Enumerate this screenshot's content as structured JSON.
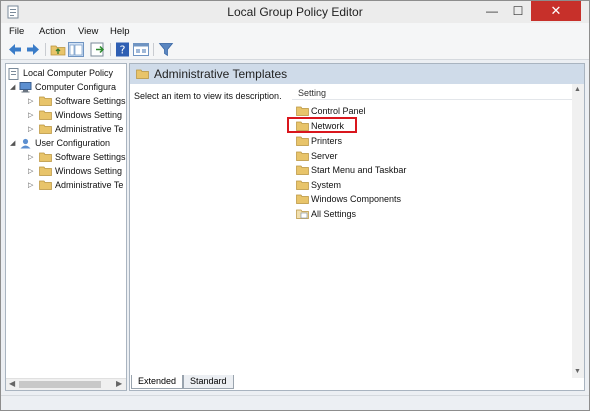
{
  "window": {
    "title": "Local Group Policy Editor",
    "close_glyph": "✕",
    "min_glyph": "—",
    "max_glyph": "☐"
  },
  "menu": [
    "File",
    "Action",
    "View",
    "Help"
  ],
  "toolbar": [
    "back-arrow-icon",
    "forward-arrow-icon",
    "up-folder-icon",
    "show-hide-tree-icon",
    "export-list-icon",
    "help-icon",
    "properties-icon",
    "filter-icon"
  ],
  "tree": {
    "root": "Local Computer Policy",
    "computer": {
      "label": "Computer Configura",
      "children": [
        "Software Settings",
        "Windows Setting",
        "Administrative Te"
      ]
    },
    "user": {
      "label": "User Configuration",
      "children": [
        "Software Settings",
        "Windows Setting",
        "Administrative Te"
      ]
    }
  },
  "right": {
    "header_title": "Administrative Templates",
    "description": "Select an item to view its description.",
    "column_header": "Setting",
    "items": [
      "Control Panel",
      "Network",
      "Printers",
      "Server",
      "Start Menu and Taskbar",
      "System",
      "Windows Components",
      "All Settings"
    ],
    "highlighted_item": "Network"
  },
  "tabs": {
    "extended": "Extended",
    "standard": "Standard"
  },
  "colors": {
    "highlight": "#d9161d",
    "folder": "#e8c46a",
    "header_band": "#cfdbe9"
  }
}
